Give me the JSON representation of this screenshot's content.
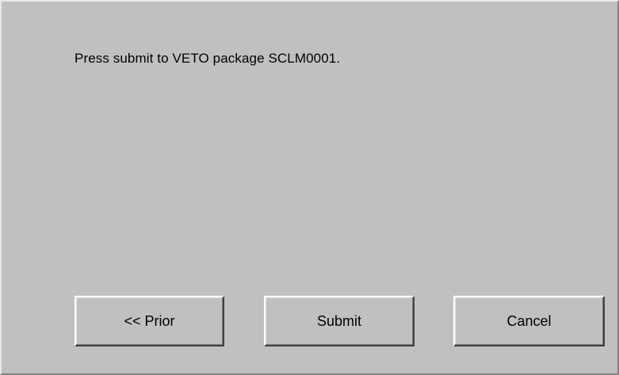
{
  "dialog": {
    "message": "Press submit to VETO package SCLM0001."
  },
  "buttons": {
    "prior_label": "<< Prior",
    "submit_label": "Submit",
    "cancel_label": "Cancel"
  },
  "colors": {
    "background": "#c0c0c0",
    "text": "#000000"
  }
}
